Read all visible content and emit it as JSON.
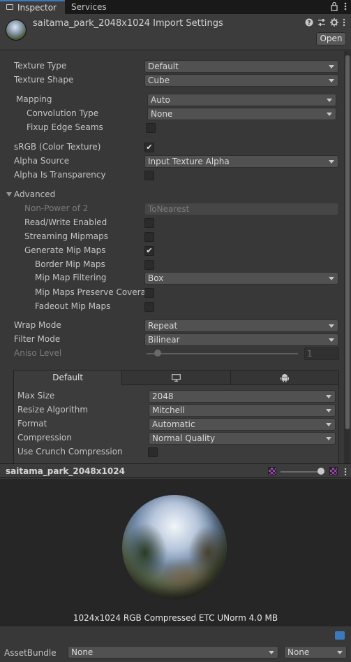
{
  "tabs": {
    "inspector": "Inspector",
    "services": "Services"
  },
  "tabbar_icons": {
    "lock": "lock-icon",
    "more": "more-icon"
  },
  "header": {
    "title": "saitama_park_2048x1024 Import Settings",
    "open_label": "Open",
    "icons": [
      "help-icon",
      "presets-icon",
      "settings-icon"
    ]
  },
  "settings": {
    "texture_type": {
      "label": "Texture Type",
      "value": "Default"
    },
    "texture_shape": {
      "label": "Texture Shape",
      "value": "Cube"
    },
    "mapping": {
      "label": "Mapping",
      "value": "Auto"
    },
    "convolution_type": {
      "label": "Convolution Type",
      "value": "None"
    },
    "fixup_edge_seams": {
      "label": "Fixup Edge Seams",
      "checked": false
    },
    "srgb": {
      "label": "sRGB (Color Texture)",
      "checked": true
    },
    "alpha_source": {
      "label": "Alpha Source",
      "value": "Input Texture Alpha"
    },
    "alpha_is_transparency": {
      "label": "Alpha Is Transparency",
      "checked": false
    },
    "advanced": {
      "label": "Advanced",
      "expanded": true
    },
    "non_power_of_2": {
      "label": "Non-Power of 2",
      "value": "ToNearest",
      "disabled": true
    },
    "read_write": {
      "label": "Read/Write Enabled",
      "checked": false
    },
    "streaming_mipmaps": {
      "label": "Streaming Mipmaps",
      "checked": false
    },
    "generate_mip_maps": {
      "label": "Generate Mip Maps",
      "checked": true
    },
    "border_mip_maps": {
      "label": "Border Mip Maps",
      "checked": false
    },
    "mip_map_filtering": {
      "label": "Mip Map Filtering",
      "value": "Box"
    },
    "mip_maps_preserve_coverage": {
      "label": "Mip Maps Preserve Coverag",
      "checked": false
    },
    "fadeout_mip_maps": {
      "label": "Fadeout Mip Maps",
      "checked": false
    },
    "wrap_mode": {
      "label": "Wrap Mode",
      "value": "Repeat"
    },
    "filter_mode": {
      "label": "Filter Mode",
      "value": "Bilinear"
    },
    "aniso_level": {
      "label": "Aniso Level",
      "value": "1",
      "disabled": true
    }
  },
  "platform": {
    "tabs": [
      {
        "label": "Default",
        "icon": ""
      },
      {
        "label": "",
        "icon": "monitor-icon"
      },
      {
        "label": "",
        "icon": "android-icon"
      }
    ],
    "max_size": {
      "label": "Max Size",
      "value": "2048"
    },
    "resize_algorithm": {
      "label": "Resize Algorithm",
      "value": "Mitchell"
    },
    "format": {
      "label": "Format",
      "value": "Automatic"
    },
    "compression": {
      "label": "Compression",
      "value": "Normal Quality"
    },
    "use_crunch": {
      "label": "Use Crunch Compression",
      "checked": false
    }
  },
  "preview": {
    "title": "saitama_park_2048x1024",
    "info": "1024x1024  RGB Compressed ETC UNorm   4.0 MB"
  },
  "asset_bundle": {
    "label": "AssetBundle",
    "name": "None",
    "variant": "None"
  },
  "colors": {
    "accent": "#3a79bb",
    "background": "#383838",
    "panel": "#3c3c3c"
  }
}
